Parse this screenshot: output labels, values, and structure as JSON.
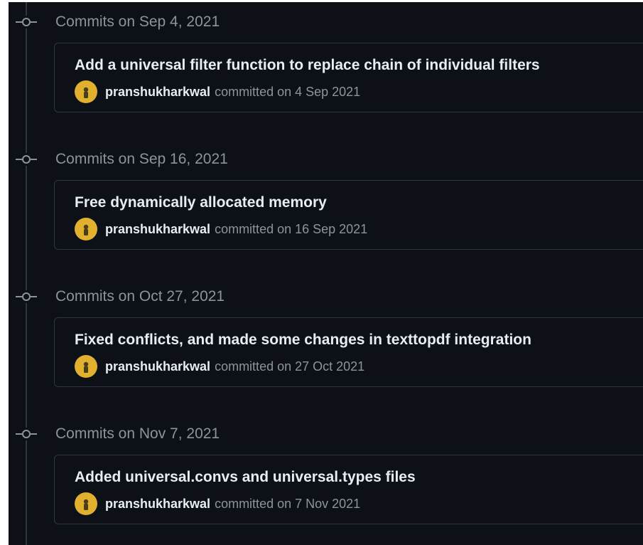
{
  "commit_groups": [
    {
      "date_header": "Commits on Sep 4, 2021",
      "commits": [
        {
          "title": "Add a universal filter function to replace chain of individual filters",
          "author": "pranshukharkwal",
          "meta": "committed on 4 Sep 2021"
        }
      ]
    },
    {
      "date_header": "Commits on Sep 16, 2021",
      "commits": [
        {
          "title": "Free dynamically allocated memory",
          "author": "pranshukharkwal",
          "meta": "committed on 16 Sep 2021"
        }
      ]
    },
    {
      "date_header": "Commits on Oct 27, 2021",
      "commits": [
        {
          "title": "Fixed conflicts, and made some changes in texttopdf integration",
          "author": "pranshukharkwal",
          "meta": "committed on 27 Oct 2021"
        }
      ]
    },
    {
      "date_header": "Commits on Nov 7, 2021",
      "commits": [
        {
          "title": "Added universal.convs and universal.types files",
          "author": "pranshukharkwal",
          "meta": "committed on 7 Nov 2021"
        }
      ]
    }
  ],
  "icons": {
    "timeline_node": "git-commit-icon",
    "avatar": "avatar-image"
  },
  "colors": {
    "background": "#0d1117",
    "border": "#30363d",
    "text_primary": "#e6edf3",
    "text_muted": "#8b949e",
    "avatar_bg": "#e0b02e"
  }
}
